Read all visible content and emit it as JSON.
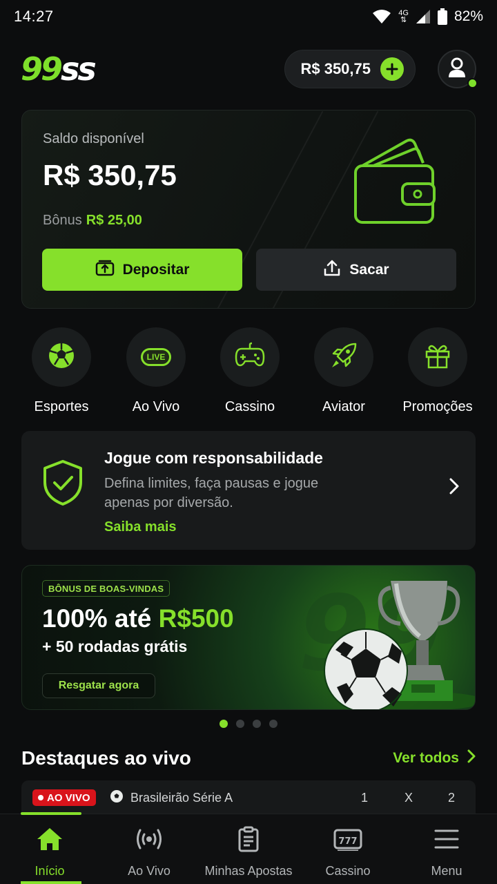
{
  "status_bar": {
    "time": "14:27",
    "network": "4G",
    "battery": "82%"
  },
  "header": {
    "logo_accent": "99",
    "logo_rest": "ss",
    "balance": "R$ 350,75"
  },
  "wallet": {
    "label": "Saldo disponível",
    "amount": "R$ 350,75",
    "bonus_label": "Bônus",
    "bonus_value": "R$ 25,00",
    "deposit_label": "Depositar",
    "withdraw_label": "Sacar"
  },
  "quick_links": [
    {
      "label": "Esportes",
      "icon": "soccer-ball-icon"
    },
    {
      "label": "Ao Vivo",
      "icon": "live-icon",
      "icon_text": "LIVE"
    },
    {
      "label": "Cassino",
      "icon": "gamepad-icon"
    },
    {
      "label": "Aviator",
      "icon": "rocket-icon"
    },
    {
      "label": "Promoções",
      "icon": "gift-icon"
    }
  ],
  "responsible": {
    "title": "Jogue com responsabilidade",
    "description": "Defina limites, faça pausas e jogue apenas por diversão.",
    "link": "Saiba mais"
  },
  "promo": {
    "tag": "BÔNUS DE BOAS-VINDAS",
    "title_prefix": "100% até ",
    "title_highlight": "R$500",
    "subtitle": "+ 50 rodadas grátis",
    "button": "Resgatar agora",
    "slide_count": 4,
    "active_slide": 1
  },
  "live": {
    "title": "Destaques ao vivo",
    "see_all": "Ver todos",
    "match": {
      "badge": "AO VIVO",
      "league": "Brasileirão Série A",
      "odds_headers": [
        "1",
        "X",
        "2"
      ]
    }
  },
  "bottom_nav": [
    {
      "label": "Início",
      "icon": "home-icon",
      "active": true
    },
    {
      "label": "Ao Vivo",
      "icon": "broadcast-icon",
      "active": false
    },
    {
      "label": "Minhas Apostas",
      "icon": "betslip-icon",
      "active": false
    },
    {
      "label": "Cassino",
      "icon": "slot-machine-icon",
      "active": false
    },
    {
      "label": "Menu",
      "icon": "hamburger-menu-icon",
      "active": false
    }
  ],
  "colors": {
    "accent": "#86e02b",
    "background": "#0c0d0e",
    "card": "#181a1b",
    "live_red": "#d9141b"
  }
}
